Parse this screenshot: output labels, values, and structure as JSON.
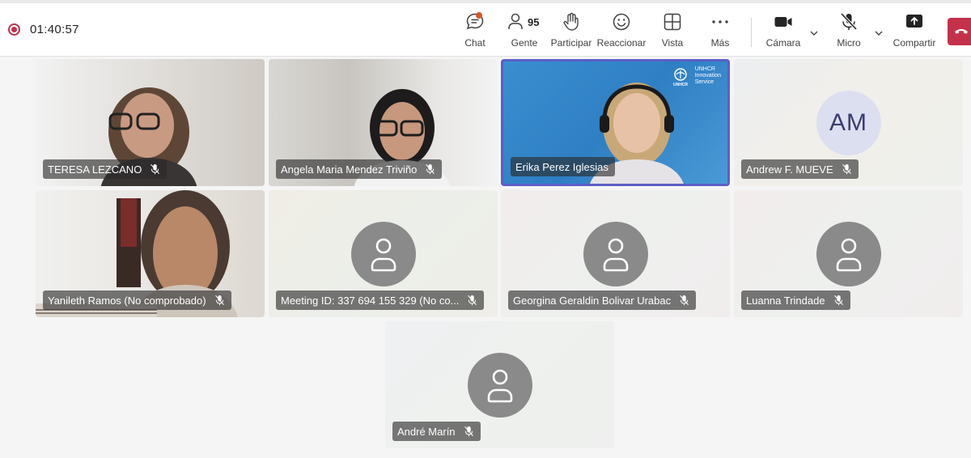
{
  "recording": {
    "timer": "01:40:57"
  },
  "toolbar": {
    "chat": "Chat",
    "people": "Gente",
    "people_count": "95",
    "raise": "Participar",
    "react": "Reaccionar",
    "view": "Vista",
    "more": "Más",
    "camera": "Cámara",
    "mic": "Micro",
    "share": "Compartir"
  },
  "participants": [
    {
      "name": "TERESA LEZCANO",
      "muted": true,
      "video": true
    },
    {
      "name": "Angela Maria Mendez Triviño",
      "muted": true,
      "video": true
    },
    {
      "name": "Erika Perez Iglesias",
      "muted": false,
      "video": true,
      "active_speaker": true,
      "background_logo": {
        "mark": "UNHCR",
        "line1": "UNHCR",
        "line2": "Innovation",
        "line3": "Service"
      }
    },
    {
      "name": "Andrew F. MUEVE",
      "muted": true,
      "video": false,
      "initials": "AM"
    },
    {
      "name": "Yanileth Ramos (No comprobado)",
      "muted": true,
      "video": true
    },
    {
      "name": "Meeting ID: 337 694 155 329 (No co...",
      "muted": true,
      "video": false
    },
    {
      "name": "Georgina Geraldin Bolivar Urabac",
      "muted": true,
      "video": false
    },
    {
      "name": "Luanna Trindade",
      "muted": true,
      "video": false
    },
    {
      "name": "André Marín",
      "muted": true,
      "video": false
    }
  ],
  "colors": {
    "accent": "#5b5fc7",
    "record": "#c4314b",
    "hangup": "#c4314b"
  },
  "icons": [
    "record-icon",
    "chat-icon",
    "people-icon",
    "hand-icon",
    "emoji-icon",
    "grid-view-icon",
    "more-icon",
    "camera-icon",
    "mic-off-icon",
    "share-icon",
    "hangup-icon",
    "avatar-icon"
  ]
}
